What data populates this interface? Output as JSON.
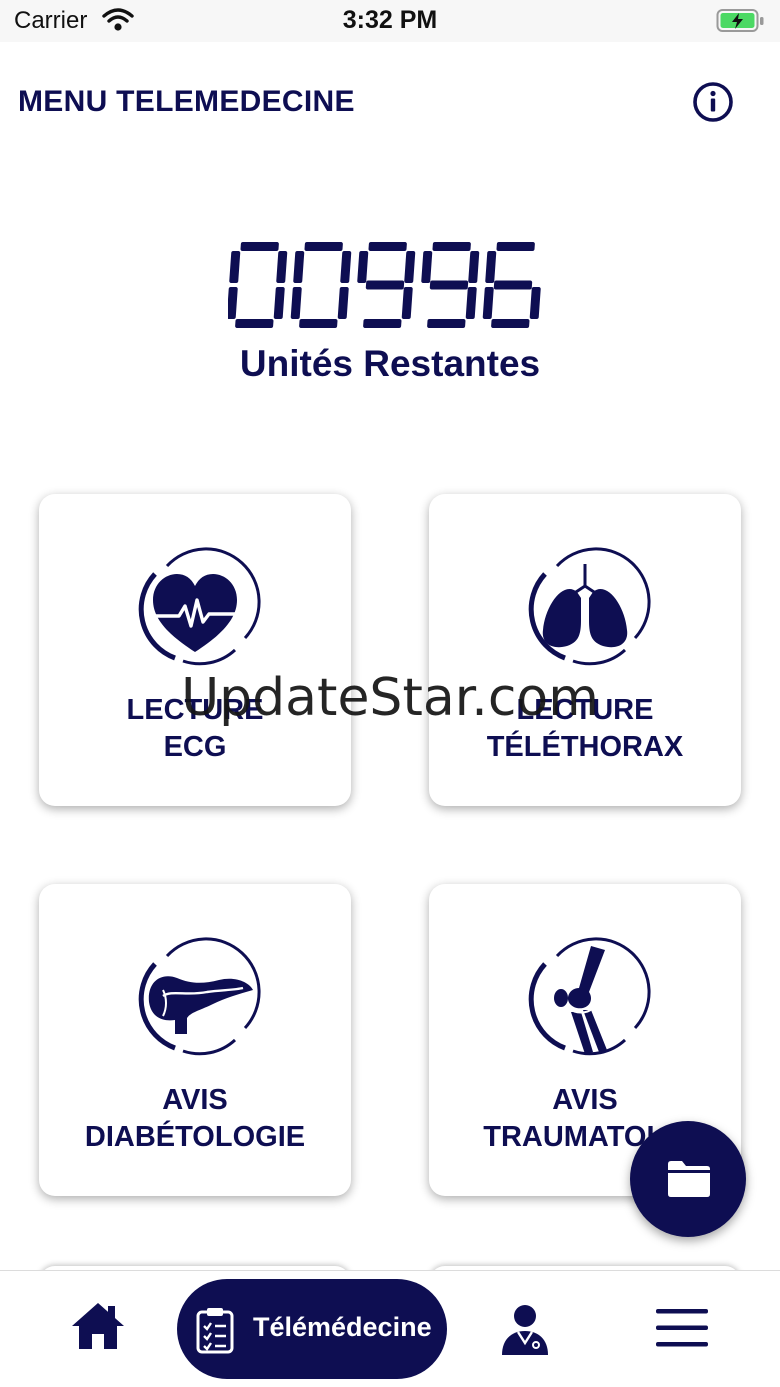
{
  "status_bar": {
    "carrier": "Carrier",
    "time": "3:32 PM"
  },
  "header": {
    "title": "MENU TELEMEDECINE",
    "info_icon": "info-icon"
  },
  "counter": {
    "value": "00996",
    "label": "Unités Restantes"
  },
  "cards": [
    {
      "id": "ecg",
      "label": "LECTURE\nECG",
      "icon": "heart-ecg-icon"
    },
    {
      "id": "thorax",
      "label": "LECTURE\nTÉLÉTHORAX",
      "icon": "lungs-icon"
    },
    {
      "id": "diabeto",
      "label": "AVIS\nDIABÉTOLOGIE",
      "icon": "pancreas-icon"
    },
    {
      "id": "trauma",
      "label": "AVIS\nTRAUMATOLO",
      "icon": "knee-joint-icon"
    }
  ],
  "watermark": "UpdateStar.com",
  "fab": {
    "icon": "folder-icon"
  },
  "bottom_nav": {
    "home_icon": "home-icon",
    "active_label": "Télémédecine",
    "active_icon": "clipboard-icon",
    "doctor_icon": "doctor-icon",
    "menu_icon": "hamburger-icon"
  },
  "colors": {
    "primary": "#0e0e52",
    "background": "#ffffff",
    "battery": "#4cd964"
  }
}
